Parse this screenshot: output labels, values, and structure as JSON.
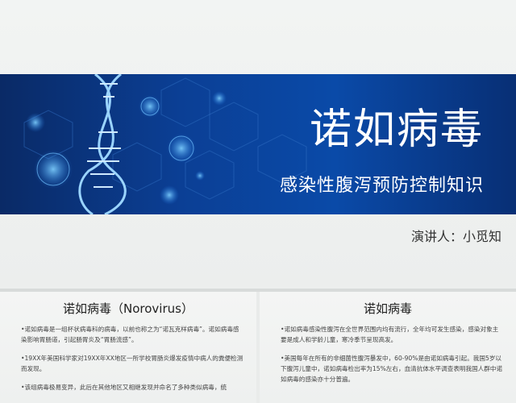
{
  "slide": {
    "title": "诺如病毒",
    "subtitle": "感染性腹泻预防控制知识",
    "speaker": "演讲人：小觅知"
  },
  "left_panel": {
    "heading": "诺如病毒（Norovirus）",
    "bullets": [
      "•诺如病毒是一组杯状病毒科的病毒，以前也称之为“诺瓦克样病毒”。诺如病毒感染影响胃肠道，引起肠胃炎及“胃肠流感”。",
      "•19XX年美国科学家对19XX年XX地区一所学校胃肠炎爆发疫情中病人的粪便检测而发现。",
      "•该组病毒极易变异，此后在其他地区又相继发现并命名了多种类似病毒，统"
    ]
  },
  "right_panel": {
    "heading": "诺如病毒",
    "bullets": [
      "•诺如病毒感染性腹泻在全世界范围内均有流行，全年均可发生感染，感染对象主要是成人和学龄儿童，寒冷季节呈现高发。",
      "•美国每年在所有的非细菌性腹泻暴发中，60-90%是由诺如病毒引起。我国5岁以下腹泻儿童中，诺如病毒检出率为15%左右，血清抗体水平调查表明我国人群中诺如病毒的感染亦十分普遍。"
    ]
  },
  "colors": {
    "banner_dark": "#0a2a66",
    "banner_mid": "#0b3f95",
    "text_white": "#ffffff"
  }
}
